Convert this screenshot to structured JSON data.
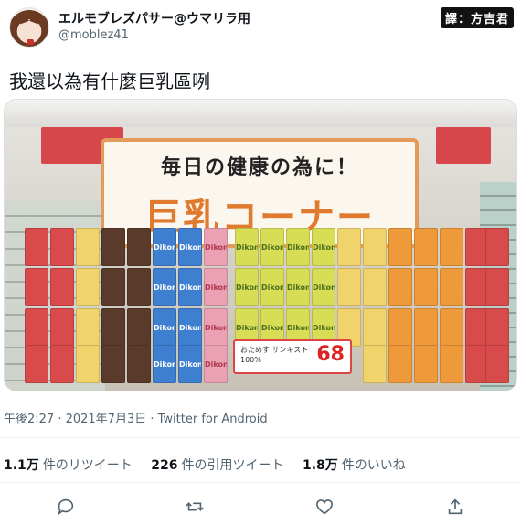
{
  "header": {
    "display_name": "エルモブレズパサー@ウマリラ用",
    "handle": "@moblez41",
    "translator_badge": "譯：方吉君"
  },
  "tweet": {
    "text": "我還以為有什麼巨乳區咧"
  },
  "photo": {
    "banner_line1": "毎日の健康の為に！",
    "banner_line2": "巨乳コーナー",
    "brand": "Dikon",
    "price_tag": {
      "name": "おためす サンキスト100%",
      "price": "68"
    }
  },
  "meta": {
    "timestamp": "午後2:27 · 2021年7月3日 · Twitter for Android"
  },
  "stats": {
    "retweets": {
      "count": "1.1万",
      "label": "件のリツイート"
    },
    "quotes": {
      "count": "226",
      "label": "件の引用ツイート"
    },
    "likes": {
      "count": "1.8万",
      "label": "件のいいね"
    }
  },
  "actions": {
    "icons": [
      "reply-icon",
      "retweet-icon",
      "like-icon",
      "share-icon"
    ]
  },
  "colors": {
    "text_primary": "#0f1419",
    "text_secondary": "#536471",
    "divider": "#eff3f4"
  }
}
